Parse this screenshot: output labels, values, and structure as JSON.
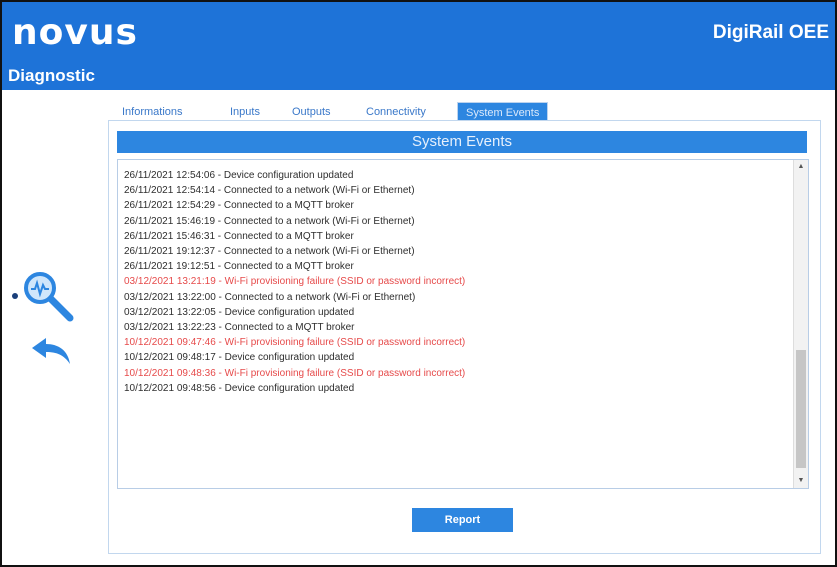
{
  "header": {
    "logo": "novus",
    "product": "DigiRail OEE",
    "page_title": "Diagnostic"
  },
  "tabs": [
    {
      "label": "Informations"
    },
    {
      "label": "Inputs"
    },
    {
      "label": "Outputs"
    },
    {
      "label": "Connectivity"
    },
    {
      "label": "System Events",
      "active": true
    }
  ],
  "panel": {
    "title": "System Events"
  },
  "events": [
    {
      "text": "26/11/2021 12:54:06 - Device configuration updated",
      "error": false
    },
    {
      "text": "26/11/2021 12:54:14 - Connected to a network (Wi-Fi or Ethernet)",
      "error": false
    },
    {
      "text": "26/11/2021 12:54:29 - Connected to a MQTT broker",
      "error": false
    },
    {
      "text": "26/11/2021 15:46:19 - Connected to a network (Wi-Fi or Ethernet)",
      "error": false
    },
    {
      "text": "26/11/2021 15:46:31 - Connected to a MQTT broker",
      "error": false
    },
    {
      "text": "26/11/2021 19:12:37 - Connected to a network (Wi-Fi or Ethernet)",
      "error": false
    },
    {
      "text": "26/11/2021 19:12:51 - Connected to a MQTT broker",
      "error": false
    },
    {
      "text": "03/12/2021 13:21:19 - Wi-Fi provisioning failure (SSID or password incorrect)",
      "error": true
    },
    {
      "text": "03/12/2021 13:22:00 - Connected to a network (Wi-Fi or Ethernet)",
      "error": false
    },
    {
      "text": "03/12/2021 13:22:05 - Device configuration updated",
      "error": false
    },
    {
      "text": "03/12/2021 13:22:23 - Connected to a MQTT broker",
      "error": false
    },
    {
      "text": "10/12/2021 09:47:46 - Wi-Fi provisioning failure (SSID or password incorrect)",
      "error": true
    },
    {
      "text": "10/12/2021 09:48:17 - Device configuration updated",
      "error": false
    },
    {
      "text": "10/12/2021 09:48:36 - Wi-Fi provisioning failure (SSID or password incorrect)",
      "error": true
    },
    {
      "text": "10/12/2021 09:48:56 - Device configuration updated",
      "error": false
    }
  ],
  "actions": {
    "report_label": "Report"
  },
  "icons": {
    "magnifier": "magnifier-icon",
    "back": "back-arrow-icon"
  },
  "colors": {
    "header_bg": "#1e73d8",
    "accent": "#2d86e0",
    "error_text": "#e64a4a"
  }
}
